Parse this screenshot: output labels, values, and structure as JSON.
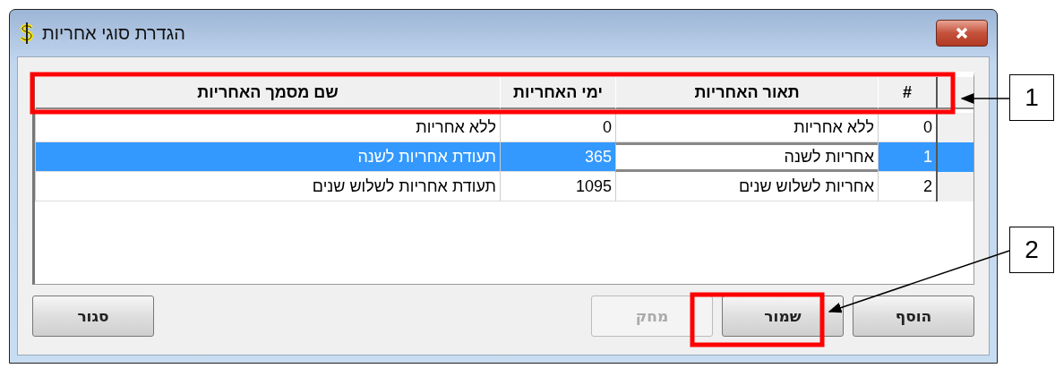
{
  "window": {
    "title": "הגדרת סוגי אחריות"
  },
  "table": {
    "columns": [
      "#",
      "תאור האחריות",
      "ימי האחריות",
      "שם מסמך האחריות"
    ],
    "rows": [
      {
        "cells": [
          "0",
          "ללא אחריות",
          "0",
          "ללא אחריות"
        ],
        "selected": false
      },
      {
        "cells": [
          "1",
          "אחריות לשנה",
          "365",
          "תעודת אחריות לשנה"
        ],
        "selected": true
      },
      {
        "cells": [
          "2",
          "אחריות לשלוש שנים",
          "1095",
          "תעודת אחריות לשלוש שנים"
        ],
        "selected": false
      }
    ]
  },
  "buttons": [
    {
      "label": "הוסף",
      "disabled": false
    },
    {
      "label": "שמור",
      "disabled": false
    },
    {
      "label": "מחק",
      "disabled": true
    },
    {
      "label": "סגור",
      "disabled": false
    }
  ],
  "annotations": [
    {
      "label": "1",
      "kind": "header"
    },
    {
      "label": "2",
      "kind": "button"
    }
  ]
}
